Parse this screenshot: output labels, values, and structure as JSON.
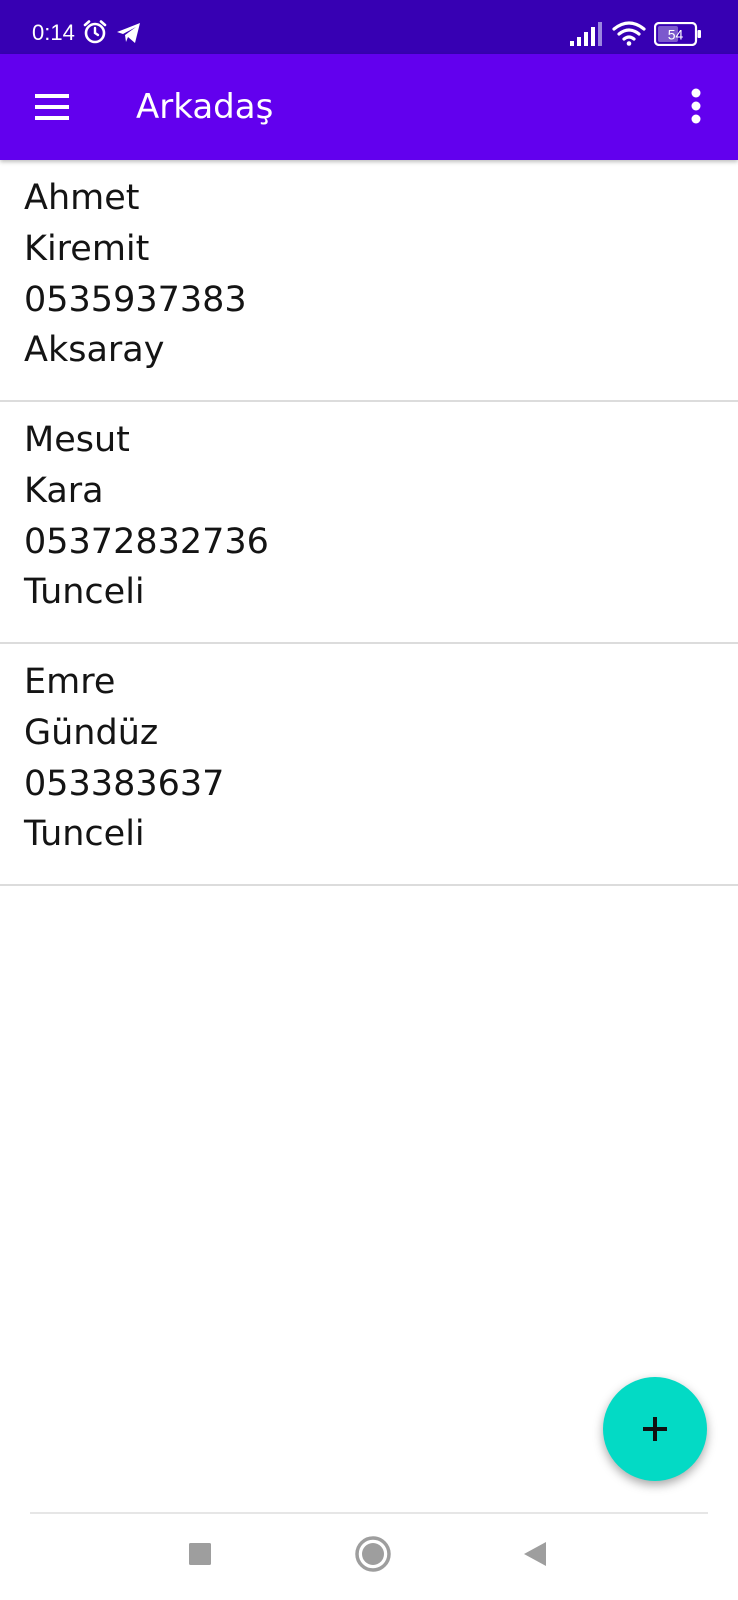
{
  "status_bar": {
    "time": "0:14",
    "battery_level": "54",
    "icons": [
      "alarm-icon",
      "telegram-icon",
      "signal-icon",
      "wifi-icon",
      "battery-icon"
    ]
  },
  "app_bar": {
    "title": "Arkadaş",
    "icons": [
      "hamburger-menu-icon",
      "more-vert-icon"
    ],
    "background": "#6200ee",
    "status_background": "#3700b3"
  },
  "contacts": [
    {
      "first_name": "Ahmet",
      "last_name": "Kiremit",
      "phone": "0535937383",
      "city": "Aksaray"
    },
    {
      "first_name": "Mesut",
      "last_name": "Kara",
      "phone": "05372832736",
      "city": "Tunceli"
    },
    {
      "first_name": "Emre",
      "last_name": "Gündüz",
      "phone": "053383637",
      "city": "Tunceli"
    }
  ],
  "fab": {
    "icon": "plus-icon",
    "color": "#03dac5"
  },
  "nav_bar": {
    "icons": [
      "recents-square-icon",
      "home-circle-icon",
      "back-triangle-icon"
    ]
  }
}
